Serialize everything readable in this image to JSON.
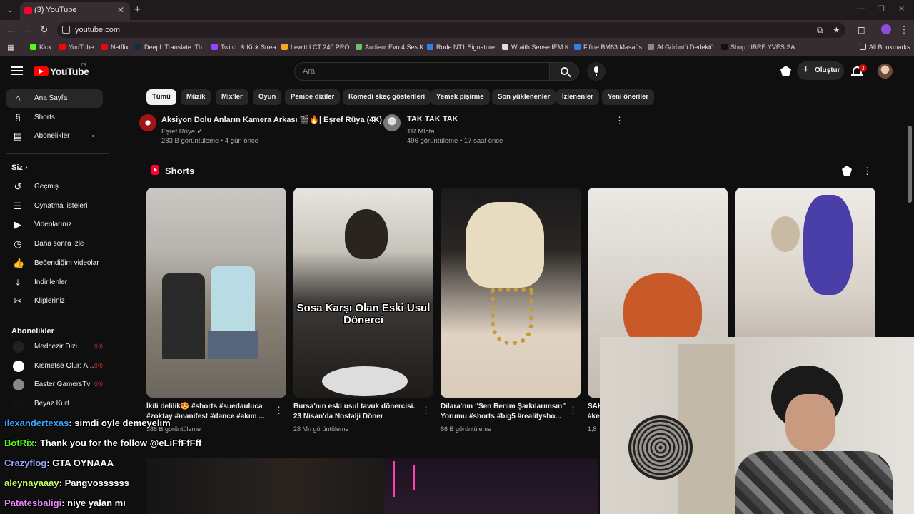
{
  "browser": {
    "tab_title": "(3) YouTube",
    "url": "youtube.com",
    "bookmarks": [
      {
        "label": "Kick",
        "color": "#53fc18"
      },
      {
        "label": "YouTube",
        "color": "#ff0000"
      },
      {
        "label": "Netflix",
        "color": "#e50914"
      },
      {
        "label": "DeepL Translate: Th...",
        "color": "#0f2b46"
      },
      {
        "label": "Twitch & Kick Strea...",
        "color": "#9146ff"
      },
      {
        "label": "Lewitt LCT 240 PRO...",
        "color": "#f5a623"
      },
      {
        "label": "Audient Evo 4 Ses K...",
        "color": "#6abf69"
      },
      {
        "label": "Rode NT1 Signature...",
        "color": "#2f80ed"
      },
      {
        "label": "Wraith Sense IEM K...",
        "color": "#dddddd"
      },
      {
        "label": "Fifine BM63 Masaüs...",
        "color": "#2f80ed"
      },
      {
        "label": "AI Görüntü Dedektö...",
        "color": "#888888"
      },
      {
        "label": "Shop LIBRE YVES SA...",
        "color": "#111111"
      }
    ],
    "all_bookmarks": "All Bookmarks"
  },
  "header": {
    "logo_text": "YouTube",
    "logo_suffix": "TR",
    "search_placeholder": "Ara",
    "create_label": "Oluştur",
    "notification_count": "3"
  },
  "sidebar": {
    "main": [
      {
        "label": "Ana Sayfa",
        "icon": "home-icon",
        "glyph": "⌂",
        "active": true
      },
      {
        "label": "Shorts",
        "icon": "shorts-icon",
        "glyph": "§"
      },
      {
        "label": "Abonelikler",
        "icon": "subscriptions-icon",
        "glyph": "▤",
        "dot": true
      }
    ],
    "you_heading": "Siz",
    "you": [
      {
        "label": "Geçmiş",
        "icon": "history-icon",
        "glyph": "↺"
      },
      {
        "label": "Oynatma listeleri",
        "icon": "playlists-icon",
        "glyph": "☰"
      },
      {
        "label": "Videolarınız",
        "icon": "your-videos-icon",
        "glyph": "▶"
      },
      {
        "label": "Daha sonra izle",
        "icon": "watch-later-icon",
        "glyph": "◷"
      },
      {
        "label": "Beğendiğim videolar",
        "icon": "liked-icon",
        "glyph": "👍"
      },
      {
        "label": "İndirilenler",
        "icon": "downloads-icon",
        "glyph": "⤓"
      },
      {
        "label": "Klipleriniz",
        "icon": "clips-icon",
        "glyph": "✂"
      }
    ],
    "subs_heading": "Abonelikler",
    "subs": [
      {
        "label": "Medcezir Dizi",
        "color": "#222222",
        "live": true
      },
      {
        "label": "Kısmetse Olur: A...",
        "color": "#ffffff",
        "live": true
      },
      {
        "label": "Easter GamersTv",
        "color": "#888888",
        "live": true
      },
      {
        "label": "Beyaz Kurt",
        "color": "#111111",
        "live": false
      }
    ]
  },
  "chips": [
    "Tümü",
    "Müzik",
    "Mix'ler",
    "Oyun",
    "Pembe diziler",
    "Komedi skeç gösterileri",
    "Yemek pişirme",
    "Son yüklenenler",
    "İzlenenler",
    "Yeni öneriler"
  ],
  "top_videos": [
    {
      "title": "Aksiyon Dolu Anların Kamera Arkası 🎬🔥| Eşref Rüya (4K)",
      "channel": "Eşref Rüya ✔",
      "meta": "283 B görüntüleme • 4 gün önce"
    },
    {
      "title": "TAK TAK TAK",
      "channel": "TR Mlota",
      "meta": "496 görüntüleme • 17 saat önce"
    }
  ],
  "shorts": {
    "title": "Shorts",
    "items": [
      {
        "caption": "İkili delilik😍 #shorts #suedauluca #zoktay #manifest #dance #akım ...",
        "views": "588 B görüntüleme"
      },
      {
        "caption": "Bursa'nın eski usul tavuk dönercisi. 23 Nisan'da Nostalji Döner",
        "views": "28 Mn görüntüleme",
        "overlay": "Sosa Karşı Olan Eski Usul Dönerci"
      },
      {
        "caption": "Dilara'nın “Sen Benim Şarkılarımsın” Yorumu #shorts #big5 #realitysho...",
        "views": "86 B görüntüleme"
      },
      {
        "caption": "SAK #ke",
        "views": "1,8"
      },
      {
        "caption": "",
        "views": ""
      }
    ]
  },
  "chat": [
    {
      "user": "ilexandertexas",
      "msg": ": simdi oyle demeyelim",
      "color": "#3ea6ff"
    },
    {
      "user": "BotRix",
      "msg": ": Thank you for the follow @eLiFfFfFff",
      "color": "#53fc18"
    },
    {
      "user": "Crazyflog",
      "msg": ": GTA OYNAAA",
      "color": "#9aa8ff"
    },
    {
      "user": "aleynayaaay",
      "msg": ": Pangvossssss",
      "color": "#c6ff66"
    },
    {
      "user": "Patatesbaligi",
      "msg": ": niye yalan mı",
      "color": "#e88bff"
    }
  ]
}
